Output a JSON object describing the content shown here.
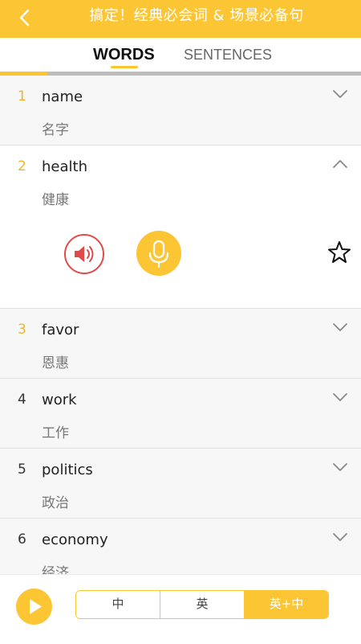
{
  "header": {
    "title": "搞定！经典必会词 & 场景必备句"
  },
  "tabs": [
    {
      "label": "WORDS",
      "active": true
    },
    {
      "label": "SENTENCES",
      "active": false
    }
  ],
  "progress": {
    "fraction": 0.13
  },
  "words": [
    {
      "num": "1",
      "word": "name",
      "translation": "名字",
      "expanded": false,
      "highlight": true
    },
    {
      "num": "2",
      "word": "health",
      "translation": "健康",
      "expanded": true,
      "highlight": true
    },
    {
      "num": "3",
      "word": "favor",
      "translation": "恩惠",
      "expanded": false,
      "highlight": true
    },
    {
      "num": "4",
      "word": "work",
      "translation": "工作",
      "expanded": false,
      "highlight": false
    },
    {
      "num": "5",
      "word": "politics",
      "translation": "政治",
      "expanded": false,
      "highlight": false
    },
    {
      "num": "6",
      "word": "economy",
      "translation": "经济",
      "expanded": false,
      "highlight": false
    }
  ],
  "footer": {
    "modes": [
      {
        "label": "中",
        "selected": false
      },
      {
        "label": "英",
        "selected": false
      },
      {
        "label": "英+中",
        "selected": true
      }
    ]
  },
  "colors": {
    "accent": "#fcc534",
    "speaker": "#e04a4a"
  },
  "icons": {
    "back": "back-arrow-icon",
    "chevron_down": "chevron-down-icon",
    "chevron_up": "chevron-up-icon",
    "speaker": "speaker-icon",
    "mic": "microphone-icon",
    "star": "star-icon",
    "play": "play-icon"
  }
}
